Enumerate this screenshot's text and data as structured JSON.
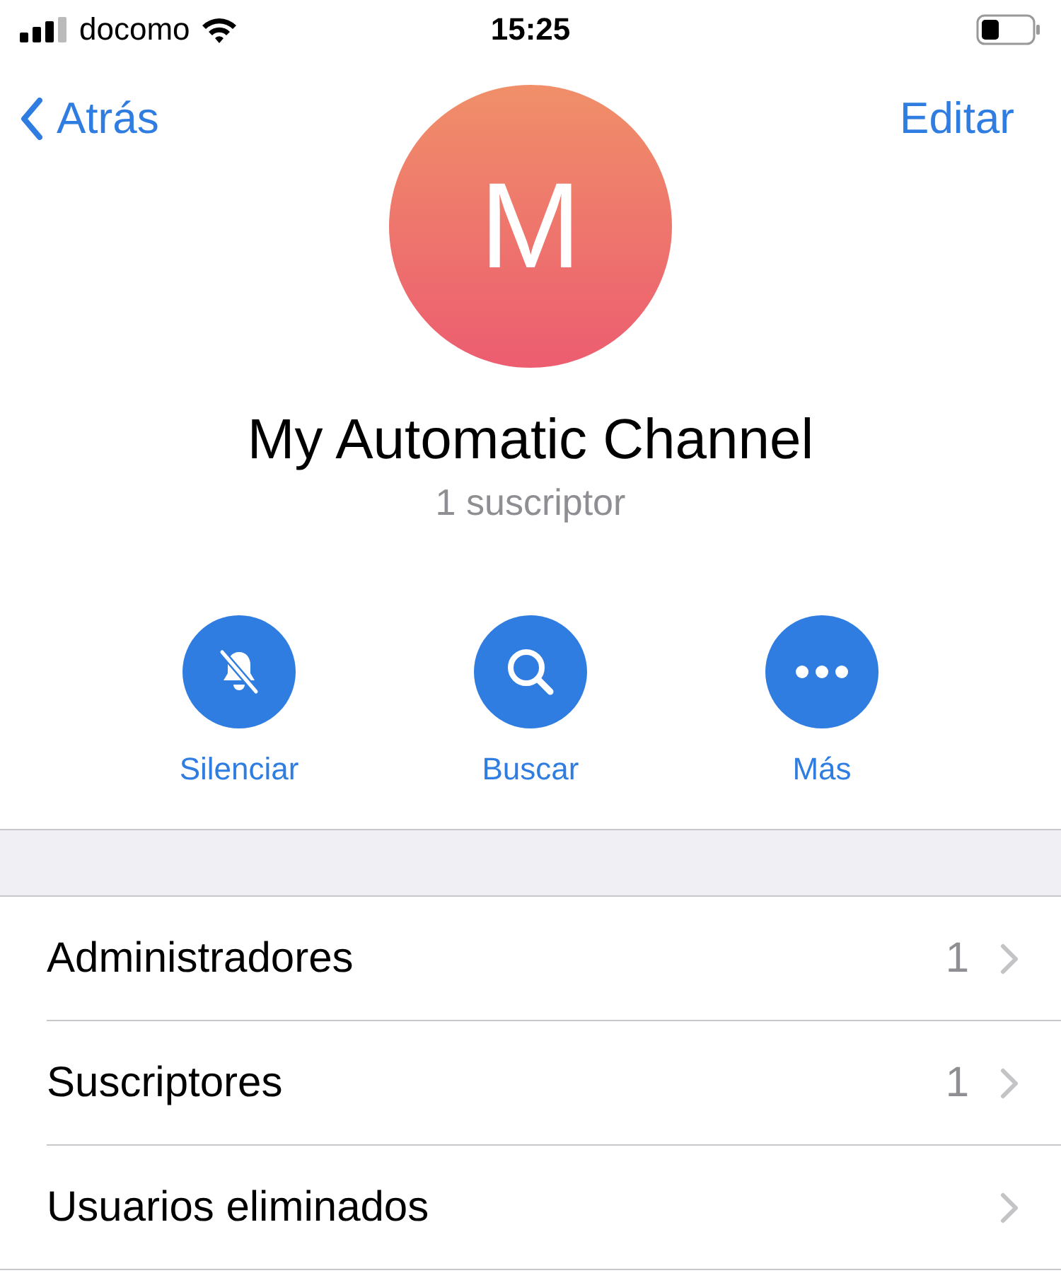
{
  "status_bar": {
    "carrier": "docomo",
    "time": "15:25"
  },
  "nav": {
    "back": "Atrás",
    "edit": "Editar"
  },
  "channel": {
    "avatar_letter": "M",
    "name": "My Automatic Channel",
    "subscribers": "1 suscriptor"
  },
  "actions": [
    {
      "kind": "mute",
      "label": "Silenciar"
    },
    {
      "kind": "search",
      "label": "Buscar"
    },
    {
      "kind": "more",
      "label": "Más"
    }
  ],
  "rows": [
    {
      "label": "Administradores",
      "count": "1"
    },
    {
      "label": "Suscriptores",
      "count": "1"
    },
    {
      "label": "Usuarios eliminados"
    }
  ]
}
